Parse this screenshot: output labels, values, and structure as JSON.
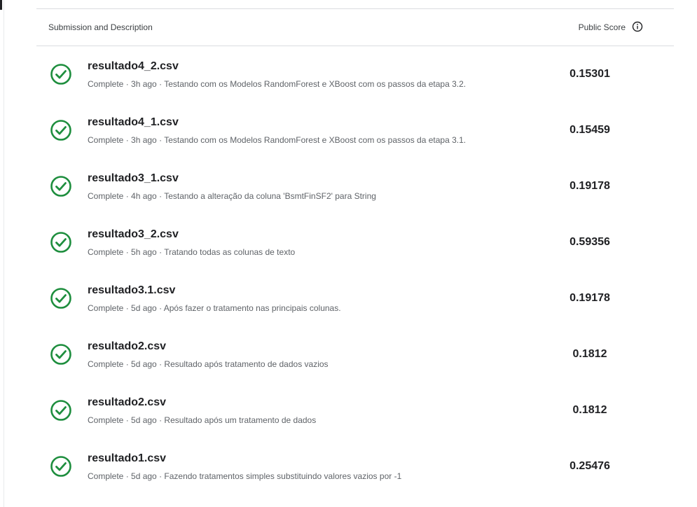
{
  "header": {
    "description_label": "Submission and Description",
    "score_label": "Public Score"
  },
  "status_color": "#1e8e3e",
  "submissions": [
    {
      "file": "resultado4_2.csv",
      "status": "Complete",
      "age": "3h ago",
      "description": "Testando com os Modelos RandomForest e XBoost com os passos da etapa 3.2.",
      "score": "0.15301"
    },
    {
      "file": "resultado4_1.csv",
      "status": "Complete",
      "age": "3h ago",
      "description": "Testando com os Modelos RandomForest e XBoost com os passos da etapa 3.1.",
      "score": "0.15459"
    },
    {
      "file": "resultado3_1.csv",
      "status": "Complete",
      "age": "4h ago",
      "description": "Testando a alteração da coluna 'BsmtFinSF2' para String",
      "score": "0.19178"
    },
    {
      "file": "resultado3_2.csv",
      "status": "Complete",
      "age": "5h ago",
      "description": "Tratando todas as colunas de texto",
      "score": "0.59356"
    },
    {
      "file": "resultado3.1.csv",
      "status": "Complete",
      "age": "5d ago",
      "description": "Após fazer o tratamento nas principais colunas.",
      "score": "0.19178"
    },
    {
      "file": "resultado2.csv",
      "status": "Complete",
      "age": "5d ago",
      "description": "Resultado após tratamento de dados vazios",
      "score": "0.1812"
    },
    {
      "file": "resultado2.csv",
      "status": "Complete",
      "age": "5d ago",
      "description": "Resultado após um tratamento de dados",
      "score": "0.1812"
    },
    {
      "file": "resultado1.csv",
      "status": "Complete",
      "age": "5d ago",
      "description": "Fazendo tratamentos simples substituindo valores vazios por -1",
      "score": "0.25476"
    }
  ]
}
